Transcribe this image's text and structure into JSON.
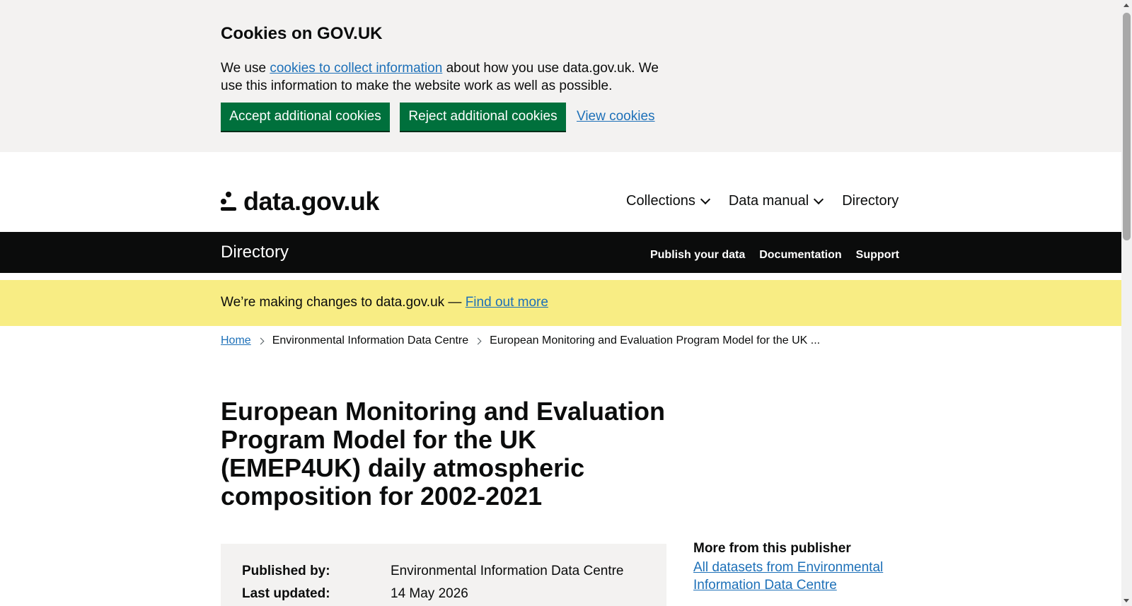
{
  "cookie_banner": {
    "title": "Cookies on GOV.UK",
    "text_before": "We use ",
    "link": "cookies to collect information",
    "text_after": " about how you use data.gov.uk. We use this information to make the website work as well as possible.",
    "accept_label": "Accept additional cookies",
    "reject_label": "Reject additional cookies",
    "view_label": "View cookies"
  },
  "header": {
    "logo_text": "data.gov.uk",
    "nav": [
      {
        "label": "Collections",
        "icon": "chevron-down-icon"
      },
      {
        "label": "Data manual",
        "icon": "chevron-down-icon"
      },
      {
        "label": "Directory"
      }
    ]
  },
  "section_bar": {
    "title": "Directory",
    "links": [
      "Publish your data",
      "Documentation",
      "Support"
    ]
  },
  "notice": {
    "text": "We’re making changes to data.gov.uk — ",
    "link": "Find out more"
  },
  "breadcrumb": [
    "Home",
    "Environmental Information Data Centre",
    "European Monitoring and Evaluation Program Model for the UK ..."
  ],
  "page_title": "European Monitoring and Evaluation Program Model for the UK (EMEP4UK) daily atmospheric composition for 2002-2021",
  "summary": {
    "published_by_label": "Published by:",
    "published_by": "Environmental Information Data Centre",
    "last_updated_label": "Last updated:",
    "last_updated": "14 May 2026"
  },
  "sidebar": {
    "heading": "More from this publisher",
    "link": "All datasets from Environmental Information Data Centre"
  },
  "colors": {
    "link": "#1d70b8",
    "button_green": "#00703c",
    "banner_grey": "#f3f2f1",
    "notice_yellow": "#f8ed84",
    "bar_black": "#0b0c0c"
  }
}
